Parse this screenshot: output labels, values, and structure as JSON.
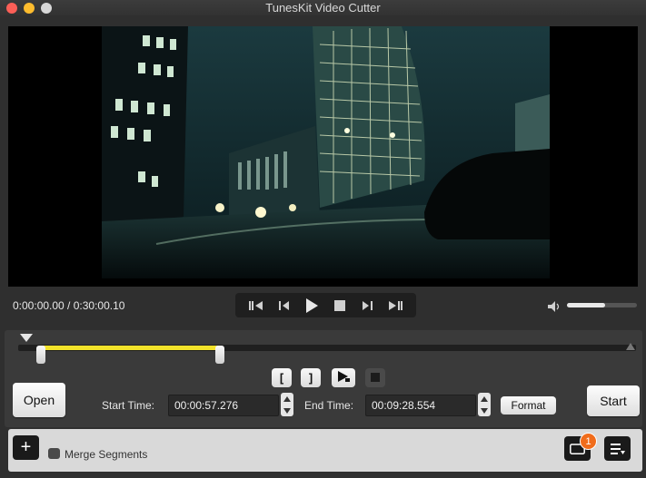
{
  "window": {
    "title": "TunesKit Video Cutter"
  },
  "player": {
    "timecode": "0:00:00.00 / 0:30:00.10",
    "volume_level": 0.55
  },
  "transport": {
    "icons": [
      "skip-to-start-icon",
      "step-back-icon",
      "play-icon",
      "stop-icon",
      "step-forward-icon",
      "skip-to-end-icon"
    ]
  },
  "segment": {
    "start_time_label": "Start Time:",
    "start_time_value": "00:00:57.276",
    "end_time_label": "End Time:",
    "end_time_value": "00:09:28.554",
    "format_label": "Format",
    "mark_in_label": "[",
    "mark_out_label": "]"
  },
  "buttons": {
    "open_label": "Open",
    "start_label": "Start",
    "add_label": "+"
  },
  "bottom": {
    "merge_label": "Merge Segments",
    "badge_count": "1"
  },
  "colors": {
    "accent_segment": "#f2e22a",
    "badge": "#f06c1b"
  }
}
